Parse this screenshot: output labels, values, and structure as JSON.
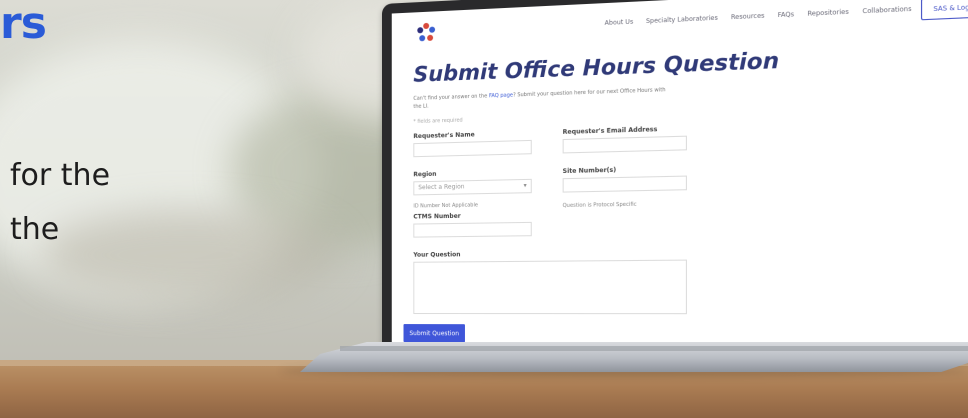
{
  "headline_fragment": "rs",
  "body_lines": [
    "for the",
    "the"
  ],
  "site": {
    "logo_icon": "flower-logo-icon",
    "nav": [
      "About Us",
      "Specialty Laboratories",
      "Resources",
      "FAQs",
      "Repositories",
      "Collaborations"
    ],
    "login_label": "SAS & Login"
  },
  "form": {
    "title": "Submit Office Hours Question",
    "intro_prefix": "Can't find your answer on the ",
    "intro_link": "FAQ page",
    "intro_suffix": "? Submit your question here for our next Office Hours with the LI.",
    "required_note": "* fields are required",
    "requester_name_label": "Requester's Name",
    "requester_email_label": "Requester's Email Address",
    "region_label": "Region",
    "region_placeholder": "Select a Region",
    "site_number_label": "Site Number(s)",
    "radio_1": "ID Number   Not Applicable",
    "radio_2": "Question is Protocol Specific",
    "ctms_label": "CTMS Number",
    "question_label": "Your Question",
    "submit_label": "Submit Question"
  },
  "colors": {
    "accent_blue": "#3f56d9",
    "headline_blue": "#2a5bd7",
    "title_navy": "#303a78"
  }
}
